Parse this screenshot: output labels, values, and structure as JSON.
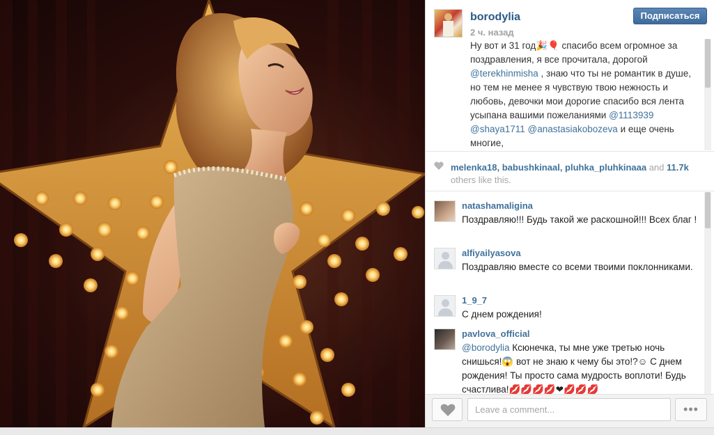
{
  "post": {
    "username": "borodylia",
    "time": "2 ч. назад",
    "follow_label": "Подписаться",
    "caption": {
      "p1": "Ну вот и 31 год🎉🎈 спасибо всем огромное за поздравления, я все прочитала, дорогой ",
      "m1": "@terekhinmisha",
      "p2": " , знаю что ты не романтик в душе, но тем не менее я чувствую твою нежность и любовь, девочки мои дорогие спасибо вся лента усыпана вашими пожеланиями ",
      "m2": "@1113939",
      "p3": " ",
      "m3": "@shaya1711",
      "p4": " ",
      "m4": "@anastasiakobozeva",
      "p5": " и еще очень многие,"
    }
  },
  "likes": {
    "u1": "melenka18",
    "sep1": ", ",
    "u2": "babushkinaal",
    "sep2": ", ",
    "u3": "pluhka_pluhkinaaa",
    "and_text": " and ",
    "count": "11.7k",
    "suffix": " others like this."
  },
  "comments": [
    {
      "user": "natashamaligina",
      "text": "Поздравляю!!! Будь такой же раскошной!!! Всех благ !"
    },
    {
      "user": "alfiyailyasova",
      "text": "Поздравляю вместе со всеми твоими поклонниками."
    },
    {
      "user": "1_9_7",
      "text": "С днем рождения!"
    },
    {
      "user": "pavlova_official",
      "mention": "@borodylia",
      "text": " Ксюнечка, ты мне уже третью ночь снишься!😱 вот не знаю к чему бы это!?☺ С днем рождения! Ты просто сама мудрость воплоти! Будь счастлива!💋💋💋💋❤💋💋💋"
    }
  ],
  "footer": {
    "comment_placeholder": "Leave a comment...",
    "more_label": "•••"
  },
  "colors": {
    "link": "#3f729b",
    "follow_button": "#4a77a8",
    "muted": "#a5a5a5"
  }
}
